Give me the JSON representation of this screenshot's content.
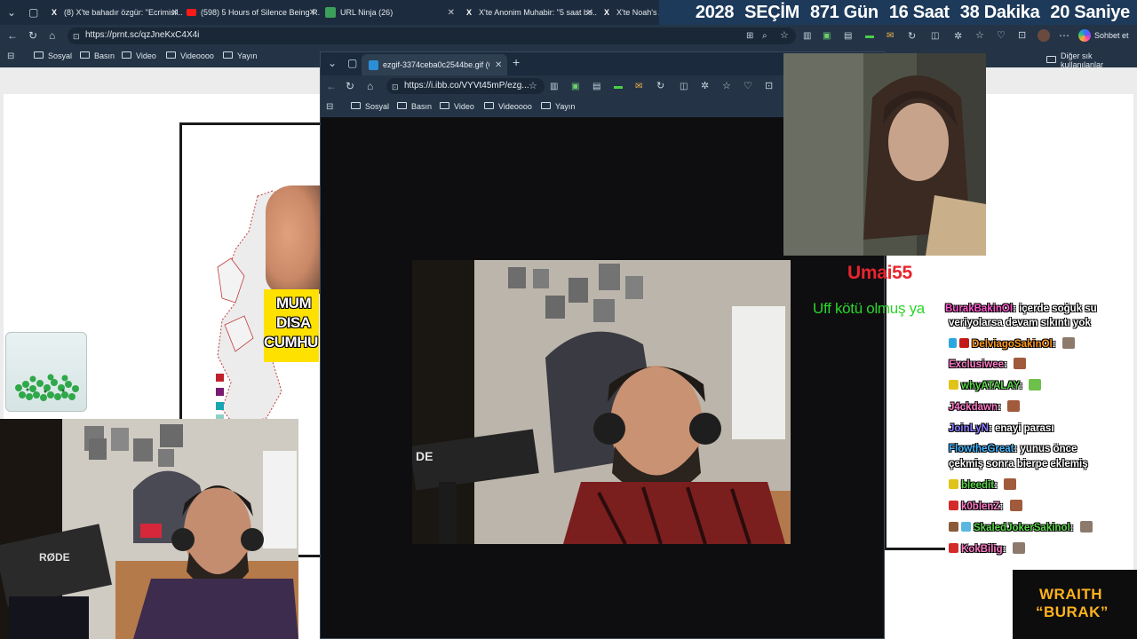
{
  "browser": {
    "tabs": [
      {
        "label": "(8) X'te bahadır özgür: \"Ecrimisil...",
        "icon": "x-icon"
      },
      {
        "label": "(598) 5 Hours of Silence Being R...",
        "icon": "youtube-icon"
      },
      {
        "label": "URL Ninja (26)",
        "icon": "urlninja-icon"
      },
      {
        "label": "X'te Anonim Muhabir: \"5 saat bo...",
        "icon": "x-icon"
      },
      {
        "label": "X'te Noah's Ar",
        "icon": "x-icon"
      }
    ],
    "url": "https://prnt.sc/qzJneKxC4X4i",
    "chat_button": "Sohbet et",
    "bookmarks": [
      "Sosyal",
      "Basın",
      "Video",
      "Videoooo",
      "Yayın"
    ],
    "other_bookmarks": "Diğer sık kullanılanlar"
  },
  "countdown": {
    "year": "2028",
    "label": "SEÇİM",
    "days": "871 Gün",
    "hours": "16 Saat",
    "minutes": "38 Dakika",
    "seconds": "20 Saniye"
  },
  "window2": {
    "tab_label": "ezgif-3374ceba0c2544be.gif (640×",
    "url": "https://i.ibb.co/VYVt45mP/ezg...",
    "bookmarks": [
      "Sosyal",
      "Basın",
      "Video",
      "Videoooo",
      "Yayın"
    ]
  },
  "map": {
    "banner_lines": [
      "MUM",
      "DISA",
      "CUMHU"
    ],
    "legend_colors": [
      "#c0202c",
      "#7a1a6e",
      "#1aa6b0",
      "#8fd0c4"
    ]
  },
  "alert": {
    "user": "Umai55",
    "message": "Uff kötü olmuş ya"
  },
  "chat": [
    {
      "user": "BurakBakinOl",
      "text": "içerde soğuk su",
      "color": "#ff5ad0",
      "badge": ""
    },
    {
      "user": "",
      "text": "veriyolarsa devam sıkıntı yok",
      "color": "#ffffff",
      "badge": ""
    },
    {
      "user": "DelviagoSakinOl",
      "text": "",
      "color": "#ff9a1e",
      "badge": "#2aa7e0",
      "emote": true
    },
    {
      "user": "Exclusiwee",
      "text": "",
      "color": "#ff7ac8",
      "badge": "",
      "emote": true
    },
    {
      "user": "whyATALAY",
      "text": "",
      "color": "#5bd64a",
      "badge": "#e0c41a",
      "emote": true
    },
    {
      "user": "J4ckdawn",
      "text": "",
      "color": "#ff7ac8",
      "badge": "",
      "emote": true
    },
    {
      "user": "JoinLyN",
      "text": "enayi parası",
      "color": "#8a7cff",
      "badge": ""
    },
    {
      "user": "FlowtheGreat",
      "text": "yunus önce",
      "color": "#42b6ff",
      "badge": ""
    },
    {
      "user": "",
      "text": "çekmiş sonra bierpe eklemiş",
      "color": "#ffffff",
      "badge": ""
    },
    {
      "user": "bleedit",
      "text": "",
      "color": "#5bd64a",
      "badge": "#e0c41a",
      "emote": true
    },
    {
      "user": "k0blenZ",
      "text": "",
      "color": "#ff7ac8",
      "badge": "#d42a2a",
      "emote": true
    },
    {
      "user": "SkaledJokerSakinol",
      "text": "",
      "color": "#5bd64a",
      "badge": "#8a5a3a",
      "emote": true
    },
    {
      "user": "KokBilig",
      "text": "",
      "color": "#ff7ac8",
      "badge": "#d42a2a",
      "emote": true
    }
  ],
  "wraith": {
    "line1": "WRAITH",
    "line2": "“BURAK”"
  }
}
